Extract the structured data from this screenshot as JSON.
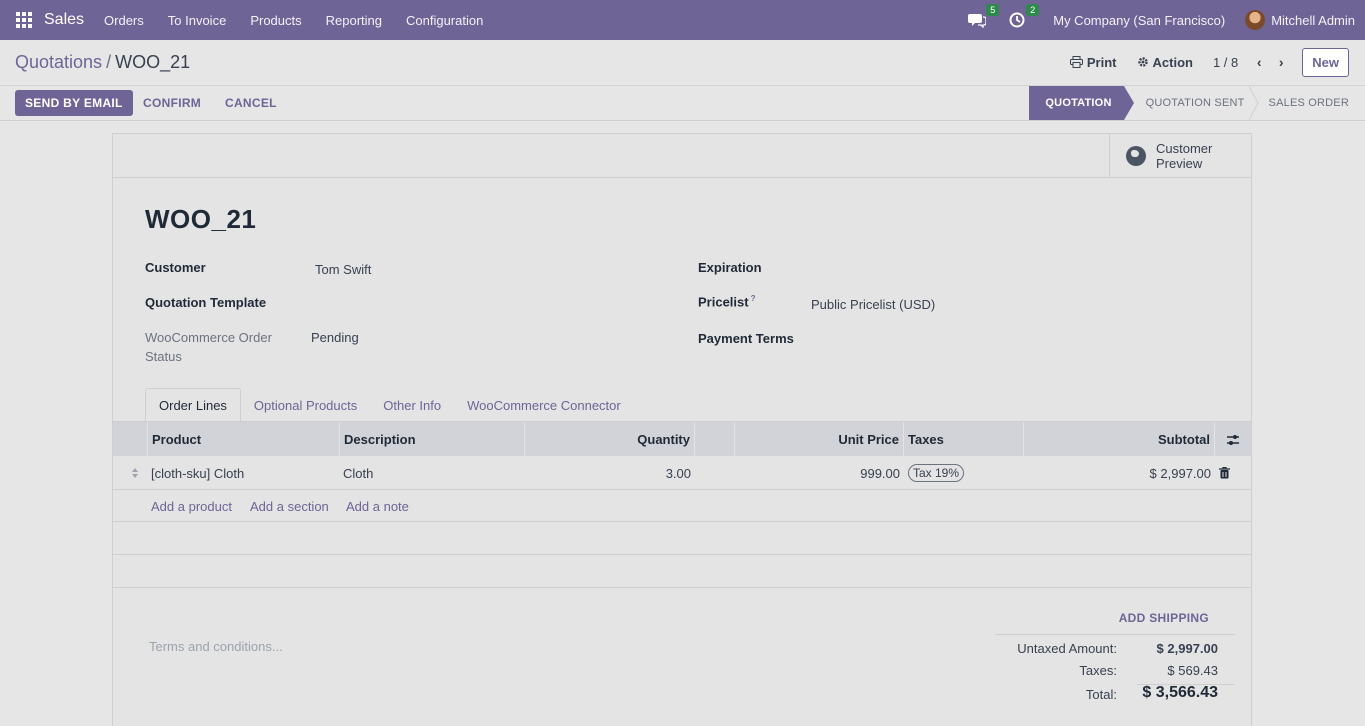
{
  "navbar": {
    "app_name": "Sales",
    "menu": [
      "Orders",
      "To Invoice",
      "Products",
      "Reporting",
      "Configuration"
    ],
    "messages_count": "5",
    "activities_count": "2",
    "company": "My Company (San Francisco)",
    "user": "Mitchell Admin"
  },
  "breadcrumb": {
    "parent": "Quotations",
    "separator": "/",
    "current": "WOO_21"
  },
  "toolbar": {
    "print_label": "Print",
    "action_label": "Action",
    "pager": "1 / 8",
    "new_label": "New"
  },
  "buttons": {
    "send_email": "SEND BY EMAIL",
    "confirm": "CONFIRM",
    "cancel": "CANCEL"
  },
  "status": [
    "QUOTATION",
    "QUOTATION SENT",
    "SALES ORDER"
  ],
  "smart_button": {
    "line1": "Customer",
    "line2": "Preview"
  },
  "record": {
    "title": "WOO_21",
    "customer_label": "Customer",
    "customer_value": "Tom Swift",
    "template_label": "Quotation Template",
    "woo_status_label_1": "WooCommerce Order",
    "woo_status_label_2": "Status",
    "woo_status_value": "Pending",
    "expiration_label": "Expiration",
    "pricelist_label": "Pricelist",
    "pricelist_help": "?",
    "pricelist_value": "Public Pricelist (USD)",
    "payment_terms_label": "Payment Terms"
  },
  "tabs": [
    "Order Lines",
    "Optional Products",
    "Other Info",
    "WooCommerce Connector"
  ],
  "order_table": {
    "columns": [
      "Product",
      "Description",
      "Quantity",
      "Unit Price",
      "Taxes",
      "Subtotal"
    ],
    "rows": [
      {
        "product": "[cloth-sku] Cloth",
        "description": "Cloth",
        "quantity": "3.00",
        "unit_price": "999.00",
        "taxes": "Tax 19%",
        "subtotal": "$ 2,997.00"
      }
    ],
    "add_product": "Add a product",
    "add_section": "Add a section",
    "add_note": "Add a note"
  },
  "footer": {
    "terms_placeholder": "Terms and conditions...",
    "add_shipping": "ADD SHIPPING",
    "untaxed_label": "Untaxed Amount:",
    "untaxed_value": "$ 2,997.00",
    "taxes_label": "Taxes:",
    "taxes_value": "$ 569.43",
    "total_label": "Total:",
    "total_value": "$ 3,566.43"
  }
}
